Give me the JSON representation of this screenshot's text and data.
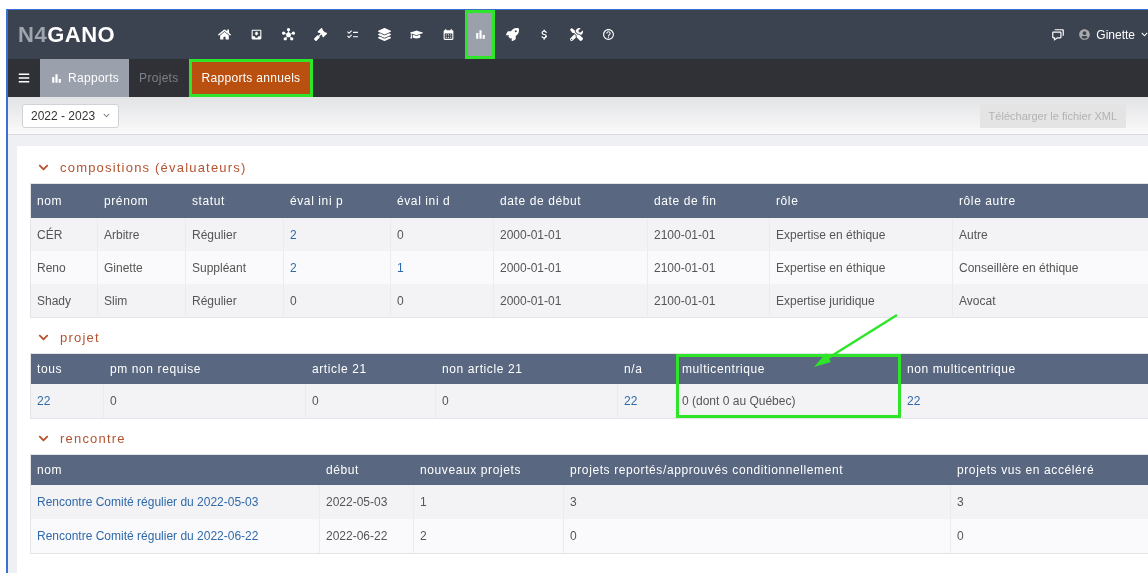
{
  "app": {
    "logo_dim": "N4",
    "logo_bright": "GANO"
  },
  "nav_icons": [
    {
      "kind": "home",
      "selected": false,
      "annotated": false
    },
    {
      "kind": "stack",
      "selected": false,
      "annotated": false
    },
    {
      "kind": "nodes",
      "selected": false,
      "annotated": false
    },
    {
      "kind": "gavel",
      "selected": false,
      "annotated": false
    },
    {
      "kind": "checklist",
      "selected": false,
      "annotated": false
    },
    {
      "kind": "layers",
      "selected": false,
      "annotated": false
    },
    {
      "kind": "graduation",
      "selected": false,
      "annotated": false
    },
    {
      "kind": "calendar",
      "selected": false,
      "annotated": false
    },
    {
      "kind": "chart",
      "selected": true,
      "annotated": true
    },
    {
      "kind": "rocket",
      "selected": false,
      "annotated": false
    },
    {
      "kind": "money",
      "selected": false,
      "annotated": false
    },
    {
      "kind": "tools",
      "selected": false,
      "annotated": false
    },
    {
      "kind": "help",
      "selected": false,
      "annotated": false
    }
  ],
  "user": {
    "name": "Ginette"
  },
  "tabs": [
    {
      "label": "Rapports",
      "kind": "module",
      "selected": true,
      "annotated": false
    },
    {
      "label": "Projets",
      "kind": "page",
      "selected": false,
      "annotated": false
    },
    {
      "label": "Rapports annuels",
      "kind": "page",
      "selected": true,
      "annotated": true
    }
  ],
  "toolbar": {
    "year_select": "2022 - 2023",
    "download_button": {
      "label": "Télécharger le fichier XML",
      "disabled": true
    }
  },
  "sections": [
    {
      "title": "compositions (évaluateurs)",
      "expanded": true,
      "columns": [
        {
          "label": "nom",
          "annotated": false
        },
        {
          "label": "prénom",
          "annotated": false
        },
        {
          "label": "statut",
          "annotated": false
        },
        {
          "label": "éval ini p",
          "annotated": false
        },
        {
          "label": "éval ini d",
          "annotated": false
        },
        {
          "label": "date de début",
          "annotated": false
        },
        {
          "label": "date de fin",
          "annotated": false
        },
        {
          "label": "rôle",
          "annotated": false
        },
        {
          "label": "rôle autre",
          "annotated": false
        }
      ],
      "rows": [
        [
          {
            "text": "CÉR",
            "link": false
          },
          {
            "text": "Arbitre",
            "link": false
          },
          {
            "text": "Régulier",
            "link": false
          },
          {
            "text": "2",
            "link": true
          },
          {
            "text": "0",
            "link": false
          },
          {
            "text": "2000-01-01",
            "link": false
          },
          {
            "text": "2100-01-01",
            "link": false
          },
          {
            "text": "Expertise en éthique",
            "link": false
          },
          {
            "text": "Autre",
            "link": false
          }
        ],
        [
          {
            "text": "Reno",
            "link": false
          },
          {
            "text": "Ginette",
            "link": false
          },
          {
            "text": "Suppléant",
            "link": false
          },
          {
            "text": "2",
            "link": true
          },
          {
            "text": "1",
            "link": true
          },
          {
            "text": "2000-01-01",
            "link": false
          },
          {
            "text": "2100-01-01",
            "link": false
          },
          {
            "text": "Expertise en éthique",
            "link": false
          },
          {
            "text": "Conseillère en éthique",
            "link": false
          }
        ],
        [
          {
            "text": "Shady",
            "link": false
          },
          {
            "text": "Slim",
            "link": false
          },
          {
            "text": "Régulier",
            "link": false
          },
          {
            "text": "0",
            "link": false
          },
          {
            "text": "0",
            "link": false
          },
          {
            "text": "2000-01-01",
            "link": false
          },
          {
            "text": "2100-01-01",
            "link": false
          },
          {
            "text": "Expertise juridique",
            "link": false
          },
          {
            "text": "Avocat",
            "link": false
          }
        ]
      ]
    },
    {
      "title": "projet",
      "expanded": true,
      "columns": [
        {
          "label": "tous",
          "annotated": false
        },
        {
          "label": "pm non requise",
          "annotated": false
        },
        {
          "label": "article 21",
          "annotated": false
        },
        {
          "label": "non article 21",
          "annotated": false
        },
        {
          "label": "n/a",
          "annotated": false
        },
        {
          "label": "multicentrique",
          "annotated": true
        },
        {
          "label": "non multicentrique",
          "annotated": false
        }
      ],
      "rows": [
        [
          {
            "text": "22",
            "link": true
          },
          {
            "text": "0",
            "link": false
          },
          {
            "text": "0",
            "link": false
          },
          {
            "text": "0",
            "link": false
          },
          {
            "text": "22",
            "link": true
          },
          {
            "text": "0 (dont 0 au Québec)",
            "link": false
          },
          {
            "text": "22",
            "link": true
          }
        ]
      ]
    },
    {
      "title": "rencontre",
      "expanded": true,
      "columns": [
        {
          "label": "nom",
          "annotated": false
        },
        {
          "label": "début",
          "annotated": false
        },
        {
          "label": "nouveaux projets",
          "annotated": false
        },
        {
          "label": "projets reportés/approuvés conditionnellement",
          "annotated": false
        },
        {
          "label": "projets vus en accéléré",
          "annotated": false
        }
      ],
      "rows": [
        [
          {
            "text": "Rencontre Comité régulier du 2022-05-03",
            "link": true
          },
          {
            "text": "2022-05-03",
            "link": false
          },
          {
            "text": "1",
            "link": false
          },
          {
            "text": "3",
            "link": false
          },
          {
            "text": "3",
            "link": false
          }
        ],
        [
          {
            "text": "Rencontre Comité régulier du 2022-06-22",
            "link": true
          },
          {
            "text": "2022-06-22",
            "link": false
          },
          {
            "text": "2",
            "link": false
          },
          {
            "text": "0",
            "link": false
          },
          {
            "text": "0",
            "link": false
          }
        ]
      ]
    }
  ]
}
